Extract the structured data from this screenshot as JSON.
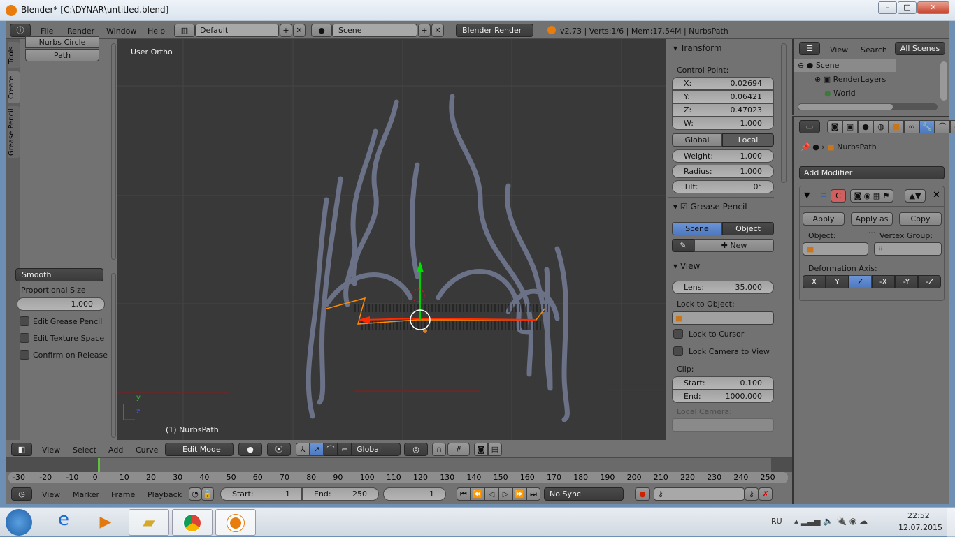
{
  "window": {
    "title": "Blender* [C:\\DYNAR\\untitled.blend]",
    "minimize": "–",
    "maximize": "□",
    "close": "✕"
  },
  "info_header": {
    "menus": [
      "File",
      "Render",
      "Window",
      "Help"
    ],
    "layout": "Default",
    "scene": "Scene",
    "engine": "Blender Render",
    "stats": "v2.73 | Verts:1/6 | Mem:17.54M | NurbsPath"
  },
  "tool_shelf": {
    "tabs": [
      "Tools",
      "Create",
      "Grease Pencil"
    ],
    "items": [
      "Nurbs Circle",
      "Path"
    ],
    "falloff": "Smooth",
    "prop_size_label": "Proportional Size",
    "prop_size_value": "1.000",
    "checks": [
      "Edit Grease Pencil",
      "Edit Texture Space",
      "Confirm on Release"
    ]
  },
  "viewport": {
    "view_name": "User Ortho",
    "object_label": "(1) NurbsPath",
    "axis_y": "y",
    "axis_z": "z"
  },
  "n_panel": {
    "transform": {
      "title": "Transform",
      "cp_label": "Control Point:",
      "fields": [
        {
          "l": "X:",
          "v": "0.02694"
        },
        {
          "l": "Y:",
          "v": "0.06421"
        },
        {
          "l": "Z:",
          "v": "0.47023"
        },
        {
          "l": "W:",
          "v": "1.000"
        }
      ],
      "global": "Global",
      "local": "Local",
      "weight": {
        "l": "Weight:",
        "v": "1.000"
      },
      "radius": {
        "l": "Radius:",
        "v": "1.000"
      },
      "tilt": {
        "l": "Tilt:",
        "v": "0°"
      }
    },
    "grease": {
      "title": "Grease Pencil",
      "scene": "Scene",
      "object": "Object",
      "new": "New"
    },
    "view": {
      "title": "View",
      "lens": {
        "l": "Lens:",
        "v": "35.000"
      },
      "lock_obj": "Lock to Object:",
      "lock_cursor": "Lock to Cursor",
      "lock_cam": "Lock Camera to View",
      "clip": "Clip:",
      "start": {
        "l": "Start:",
        "v": "0.100"
      },
      "end": {
        "l": "End:",
        "v": "1000.000"
      },
      "local_cam": "Local Camera:"
    }
  },
  "outliner": {
    "view": "View",
    "search": "Search",
    "filter": "All Scenes",
    "items": [
      "Scene",
      "RenderLayers",
      "World"
    ]
  },
  "properties": {
    "object": "NurbsPath",
    "add_modifier": "Add Modifier",
    "mod_letter": "C",
    "apply": "Apply",
    "apply_as": "Apply as ...",
    "copy": "Copy",
    "object_label": "Object:",
    "vgroup_label": "Vertex Group:",
    "deform_label": "Deformation Axis:",
    "axes": [
      "X",
      "Y",
      "Z",
      "-X",
      "-Y",
      "-Z"
    ],
    "active_axis": "Z"
  },
  "view3d_header": {
    "menus": [
      "View",
      "Select",
      "Add",
      "Curve"
    ],
    "mode": "Edit Mode",
    "orientation": "Global"
  },
  "timeline": {
    "ticks": [
      "-30",
      "-20",
      "-10",
      "0",
      "10",
      "20",
      "30",
      "40",
      "50",
      "60",
      "70",
      "80",
      "90",
      "100",
      "110",
      "120",
      "130",
      "140",
      "150",
      "160",
      "170",
      "180",
      "190",
      "200",
      "210",
      "220",
      "230",
      "240",
      "250"
    ],
    "current_frame": 1,
    "menus": [
      "View",
      "Marker",
      "Frame",
      "Playback"
    ],
    "start": {
      "l": "Start:",
      "v": "1"
    },
    "end": {
      "l": "End:",
      "v": "250"
    },
    "frame": "1",
    "sync": "No Sync"
  },
  "taskbar": {
    "lang": "RU",
    "time": "22:52",
    "date": "12.07.2015"
  },
  "colors": {
    "viewport_bg": "#393939",
    "ui_bg": "#727272",
    "accent_blue": "#5680c2",
    "curve_red": "#ff2a00"
  }
}
